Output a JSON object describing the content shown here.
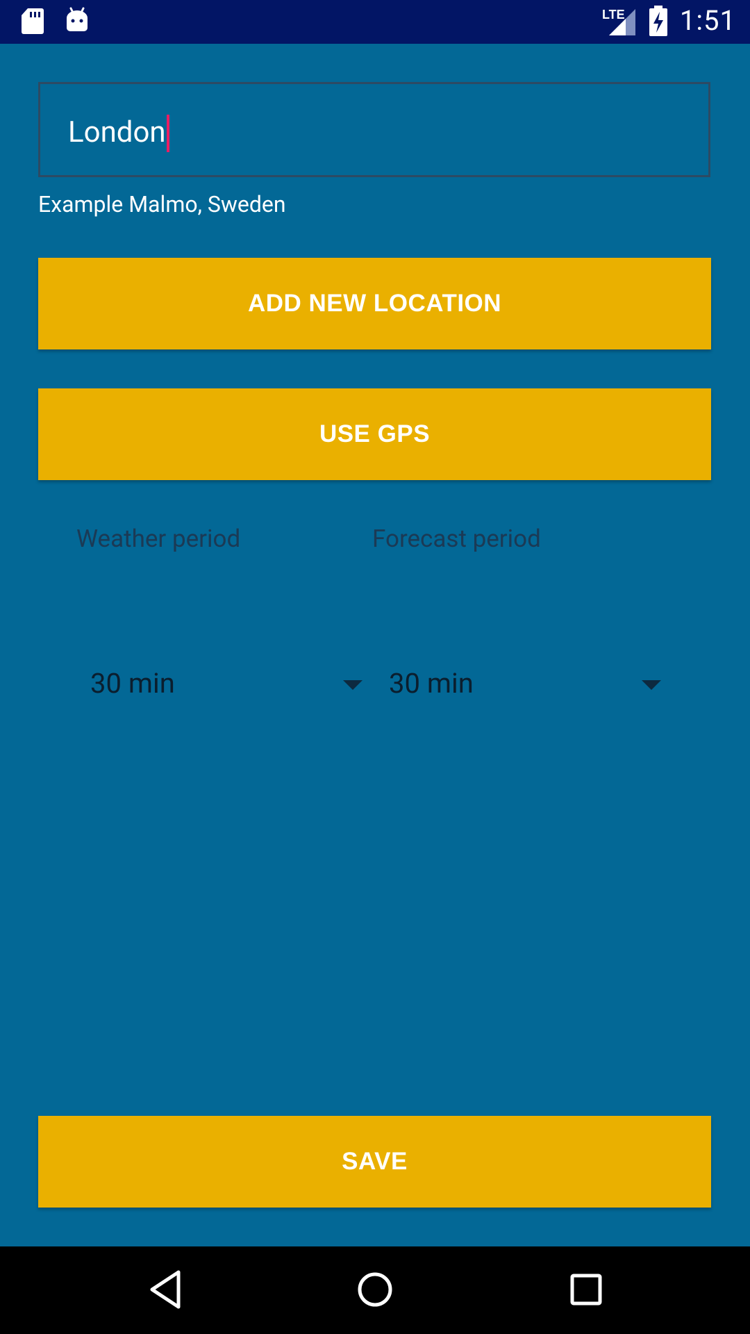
{
  "status_bar": {
    "time": "1:51",
    "network": "LTE",
    "icons": [
      "sd-card-icon",
      "android-icon",
      "signal-icon",
      "battery-charging-icon"
    ]
  },
  "form": {
    "location_value": "London",
    "location_hint": "Example Malmo, Sweden",
    "add_location_label": "ADD NEW LOCATION",
    "use_gps_label": "USE GPS",
    "weather_period_label": "Weather period",
    "forecast_period_label": "Forecast period",
    "weather_period_value": "30 min",
    "forecast_period_value": "30 min",
    "save_label": "SAVE"
  },
  "nav_bar": {
    "icons": [
      "back-icon",
      "home-icon",
      "recent-apps-icon"
    ]
  },
  "colors": {
    "background": "#036896",
    "status_bar": "#021565",
    "button": "#eab000",
    "caret": "#e91e63",
    "nav_bar": "#000000"
  }
}
